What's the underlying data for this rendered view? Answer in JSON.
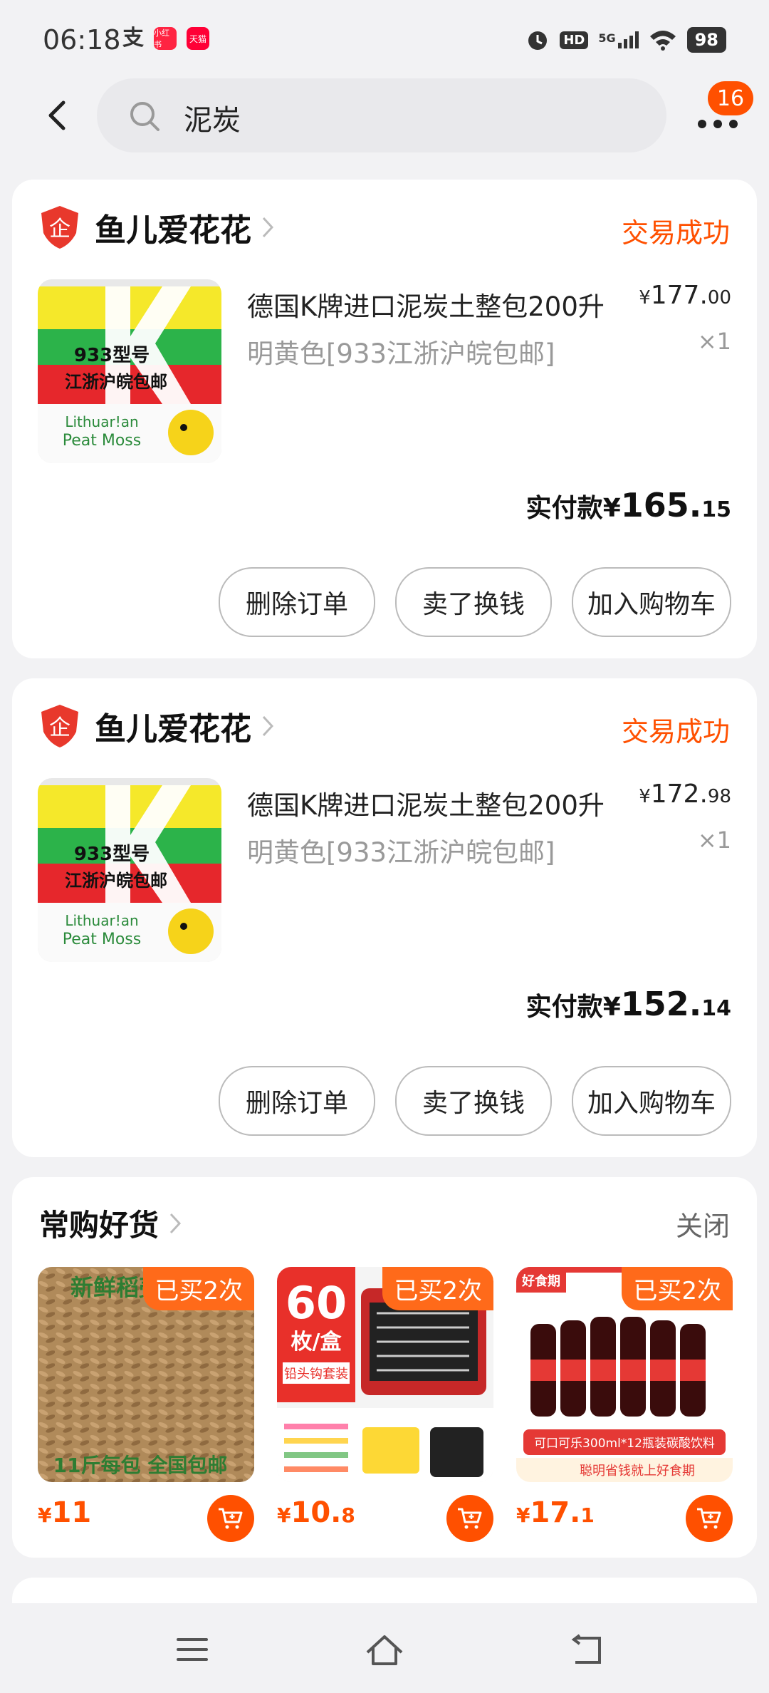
{
  "status_bar": {
    "time": "06:18",
    "app_icons": [
      "支",
      "小红书",
      "天猫"
    ],
    "network": "5G",
    "hd": "HD",
    "battery": "98"
  },
  "search": {
    "query": "泥炭",
    "badge_count": "16"
  },
  "orders": [
    {
      "shop_name": "鱼儿爱花花",
      "status": "交易成功",
      "title": "德国K牌进口泥炭土整包200升",
      "spec": "明黄色[933江浙沪皖包邮]",
      "price_symbol": "¥",
      "price_int": "177.",
      "price_dec": "00",
      "qty": "×1",
      "paid_label": "实付款",
      "paid_symbol": "¥",
      "paid_int": "165.",
      "paid_dec": "15",
      "img_text": [
        "933型号",
        "江浙沪皖包邮",
        "Lithuar!an",
        "Peat Moss"
      ],
      "actions": [
        "删除订单",
        "卖了换钱",
        "加入购物车"
      ]
    },
    {
      "shop_name": "鱼儿爱花花",
      "status": "交易成功",
      "title": "德国K牌进口泥炭土整包200升",
      "spec": "明黄色[933江浙沪皖包邮]",
      "price_symbol": "¥",
      "price_int": "172.",
      "price_dec": "98",
      "qty": "×1",
      "paid_label": "实付款",
      "paid_symbol": "¥",
      "paid_int": "152.",
      "paid_dec": "14",
      "img_text": [
        "933型号",
        "江浙沪皖包邮",
        "Lithuar!an",
        "Peat Moss"
      ],
      "actions": [
        "删除订单",
        "卖了换钱",
        "加入购物车"
      ]
    }
  ],
  "frequent": {
    "title": "常购好货",
    "close_label": "关闭",
    "items": [
      {
        "tag": "已买2次",
        "price_symbol": "¥",
        "price_int": "11",
        "price_dec": "",
        "img_top": "新鲜稻壳",
        "img_bottom": "11斤每包 全国包邮"
      },
      {
        "tag": "已买2次",
        "price_symbol": "¥",
        "price_int": "10.",
        "price_dec": "8",
        "img_top": "60",
        "img_sub": "枚/盒",
        "img_label": "铅头钩套装"
      },
      {
        "tag": "已买2次",
        "price_symbol": "¥",
        "price_int": "17.",
        "price_dec": "1",
        "img_top": "好食期",
        "img_label": "可口可乐300ml*12瓶装碳酸饮料",
        "img_bottom": "聪明省钱就上好食期"
      }
    ]
  },
  "colors": {
    "accent": "#ff5000",
    "background": "#f2f2f4"
  }
}
